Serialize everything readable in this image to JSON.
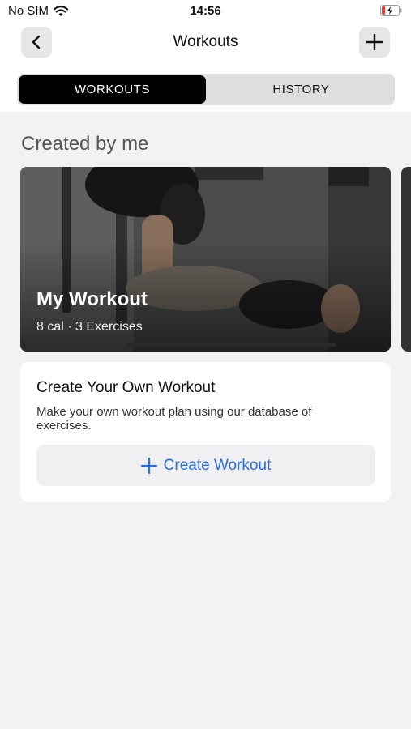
{
  "status_bar": {
    "carrier": "No SIM",
    "time": "14:56"
  },
  "header": {
    "title": "Workouts"
  },
  "segments": [
    {
      "label": "WORKOUTS",
      "active": true
    },
    {
      "label": "HISTORY",
      "active": false
    }
  ],
  "section_title": "Created by me",
  "workout_card": {
    "title": "My Workout",
    "subtitle": "8 cal · 3 Exercises"
  },
  "create_card": {
    "title": "Create Your Own Workout",
    "description": "Make your own workout plan using our database of exercises.",
    "button_label": "Create Workout"
  },
  "colors": {
    "accent": "#2a6fdb",
    "segment_active": "#000000",
    "background": "#f2f2f2"
  }
}
